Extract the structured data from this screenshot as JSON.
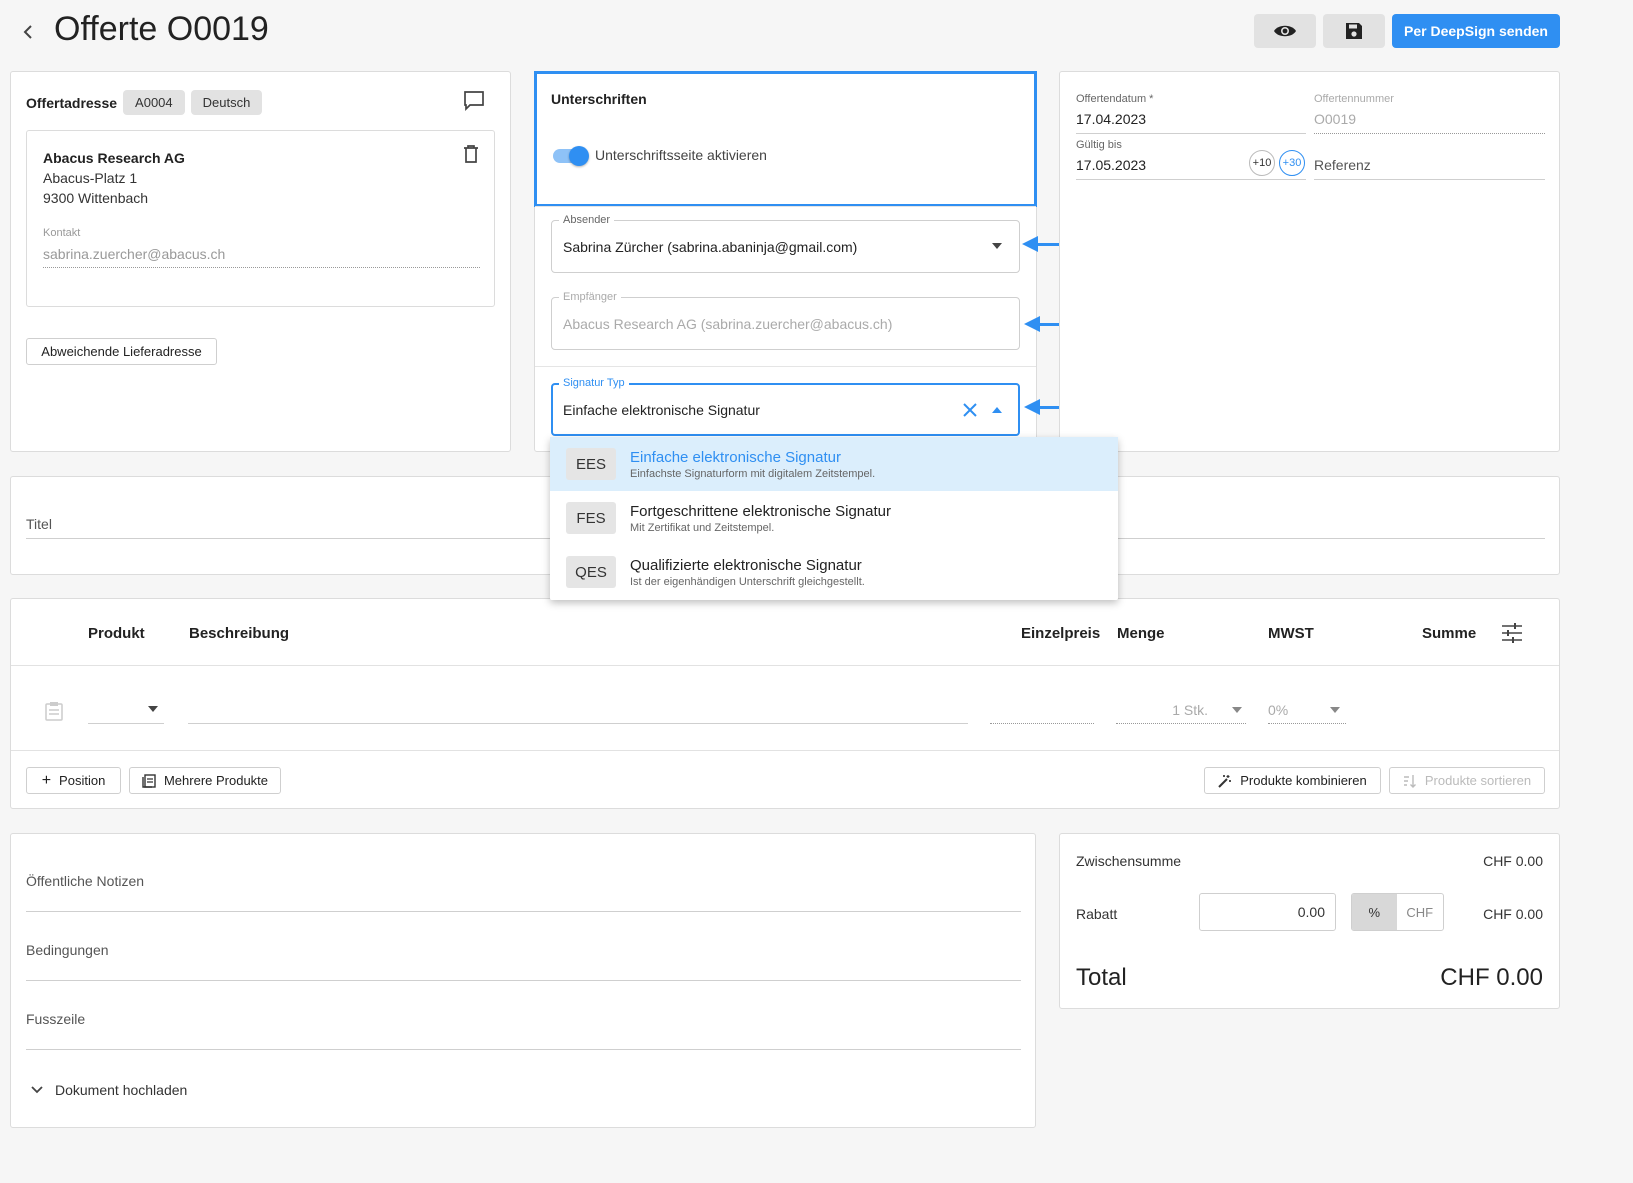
{
  "header": {
    "back_icon": "chevron-left-icon",
    "title": "Offerte O0019",
    "preview_icon": "eye-icon",
    "save_icon": "save-icon",
    "send_label": "Per DeepSign senden"
  },
  "address_card": {
    "title": "Offertadresse",
    "chip_number": "A0004",
    "chip_language": "Deutsch",
    "company": "Abacus Research AG",
    "street": "Abacus-Platz 1",
    "city": "9300 Wittenbach",
    "contact_label": "Kontakt",
    "contact_value": "sabrina.zuercher@abacus.ch",
    "alt_delivery_label": "Abweichende Lieferadresse"
  },
  "signatures": {
    "title": "Unterschriften",
    "toggle_label": "Unterschriftsseite aktivieren",
    "toggle_on": true,
    "sender_label": "Absender",
    "sender_value": "Sabrina Zürcher (sabrina.abaninja@gmail.com)",
    "recipient_label": "Empfänger",
    "recipient_value": "Abacus Research AG (sabrina.zuercher@abacus.ch)",
    "sigtype_label": "Signatur Typ",
    "sigtype_value": "Einfache elektronische Signatur",
    "options": [
      {
        "code": "EES",
        "title": "Einfache elektronische Signatur",
        "subtitle": "Einfachste Signaturform mit digitalem Zeitstempel."
      },
      {
        "code": "FES",
        "title": "Fortgeschrittene elektronische Signatur",
        "subtitle": "Mit Zertifikat und Zeitstempel."
      },
      {
        "code": "QES",
        "title": "Qualifizierte elektronische Signatur",
        "subtitle": "Ist der eigenhändigen Unterschrift gleichgestellt."
      }
    ]
  },
  "meta": {
    "date_label": "Offertendatum *",
    "date_value": "17.04.2023",
    "number_label": "Offertennummer",
    "number_value": "O0019",
    "valid_label": "Gültig bis",
    "valid_value": "17.05.2023",
    "plus10": "+10",
    "plus30": "+30",
    "reference_placeholder": "Referenz"
  },
  "title_card": {
    "placeholder": "Titel"
  },
  "table": {
    "headers": [
      "Produkt",
      "Beschreibung",
      "Einzelpreis",
      "Menge",
      "MWST",
      "Summe"
    ],
    "row": {
      "quantity": "1 Stk.",
      "vat": "0%"
    },
    "add_position": "Position",
    "multiple_products": "Mehrere Produkte",
    "combine_products": "Produkte kombinieren",
    "sort_products": "Produkte sortieren"
  },
  "notes": {
    "public_notes": "Öffentliche Notizen",
    "conditions": "Bedingungen",
    "footer": "Fusszeile",
    "upload": "Dokument hochladen"
  },
  "totals": {
    "subtotal_label": "Zwischensumme",
    "subtotal_value": "CHF 0.00",
    "discount_label": "Rabatt",
    "discount_input": "0.00",
    "unit_percent": "%",
    "unit_chf": "CHF",
    "discount_value": "CHF 0.00",
    "total_label": "Total",
    "total_value": "CHF 0.00"
  },
  "colors": {
    "accent": "#2f8ff2",
    "menu_highlight": "#dbeefc"
  }
}
